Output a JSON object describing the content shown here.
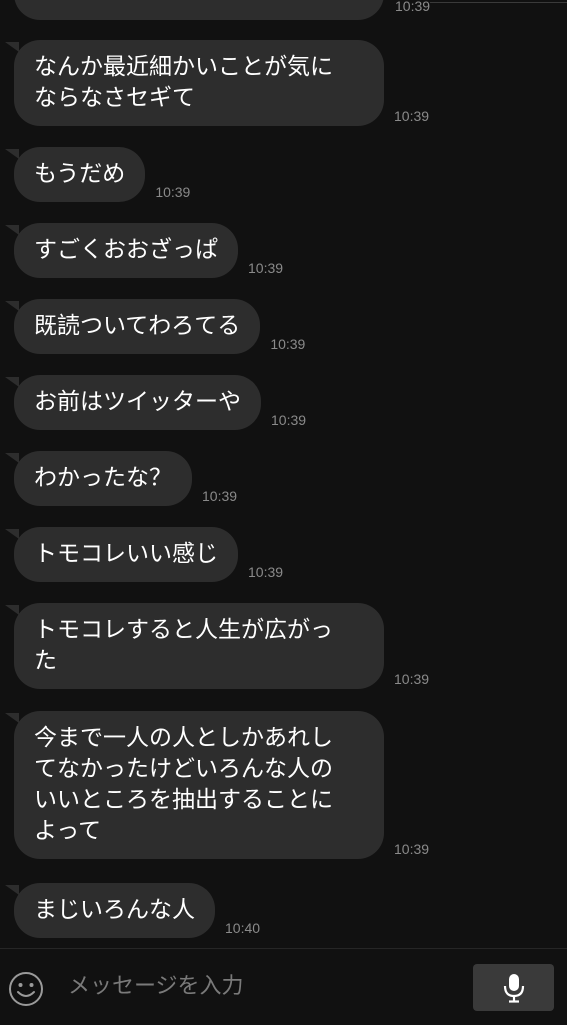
{
  "partial_top": {
    "time": "10:39"
  },
  "messages": [
    {
      "text": "なんか最近細かいことが気に\nならなさセギて",
      "time": "10:39"
    },
    {
      "text": "もうだめ",
      "time": "10:39"
    },
    {
      "text": "すごくおおざっぱ",
      "time": "10:39"
    },
    {
      "text": "既読ついてわろてる",
      "time": "10:39"
    },
    {
      "text": "お前はツイッターや",
      "time": "10:39"
    },
    {
      "text": "わかったな？",
      "time": "10:39"
    },
    {
      "text": "トモコレいい感じ",
      "time": "10:39"
    },
    {
      "text": "トモコレすると人生が広がっ\nた",
      "time": "10:39"
    },
    {
      "text": "今まで一人の人としかあれし\nてなかったけどいろんな人の\nいいところを抽出することに\nよって",
      "time": "10:39"
    },
    {
      "text": "まじいろんな人",
      "time": "10:40"
    }
  ],
  "input": {
    "placeholder": "メッセージを入力",
    "emoji_icon": "smiley-icon",
    "mic_icon": "microphone-icon"
  }
}
